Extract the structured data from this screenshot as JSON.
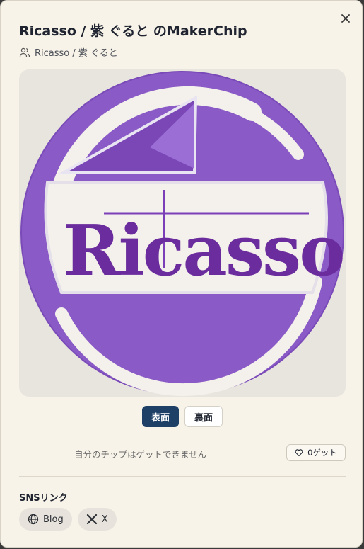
{
  "header": {
    "title": "Ricasso / 紫 ぐると のMakerChip",
    "owner": "Ricasso / 紫 ぐると"
  },
  "image": {
    "alt_text": "Ricasso"
  },
  "tabs": [
    {
      "label": "表面",
      "active": true
    },
    {
      "label": "裏面",
      "active": false
    }
  ],
  "notice": "自分のチップはゲットできません",
  "get": {
    "count": "0",
    "label": "ゲット"
  },
  "sns": {
    "title": "SNSリンク",
    "links": [
      {
        "label": "Blog",
        "icon": "globe-icon"
      },
      {
        "label": "X",
        "icon": "x-logo-icon"
      }
    ]
  },
  "colors": {
    "primary": "#1e3f66",
    "purple": "#8a5ac6",
    "background": "#f8f3e8"
  }
}
